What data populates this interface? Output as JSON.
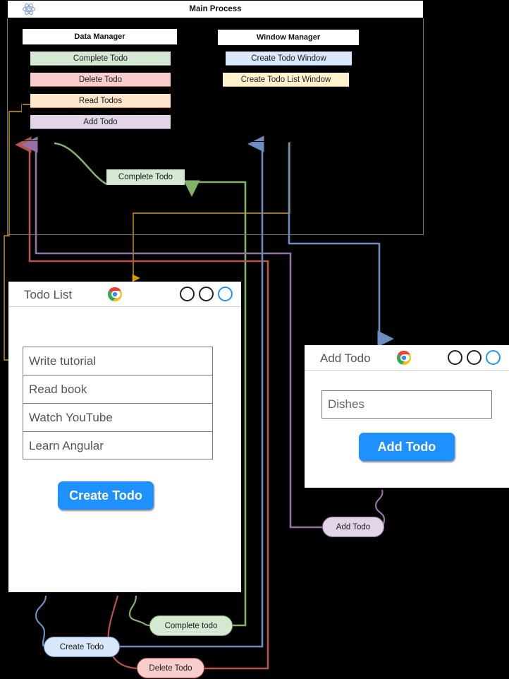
{
  "main_process": {
    "title": "Main Process",
    "icon": "atom-icon"
  },
  "data_manager": {
    "title": "Data Manager",
    "items": [
      {
        "label": "Complete Todo",
        "color": "#d5e8d4",
        "border": "#82b366"
      },
      {
        "label": "Delete Todo",
        "color": "#f8cecc",
        "border": "#b85450"
      },
      {
        "label": "Read Todos",
        "color": "#ffe6cc",
        "border": "#d79b00"
      },
      {
        "label": "Add Todo",
        "color": "#e1d5e7",
        "border": "#9673a6"
      }
    ]
  },
  "window_manager": {
    "title": "Window Manager",
    "items": [
      {
        "label": "Create Todo Window",
        "color": "#dae8fc",
        "border": "#6c8ebf"
      },
      {
        "label": "Create Todo List Window",
        "color": "#fff2cc",
        "border": "#d6b656"
      }
    ]
  },
  "flow_labels": {
    "complete_todo_top": "Complete Todo",
    "add_todo": "Add Todo",
    "complete_todo": "Complete todo",
    "create_todo": "Create Todo",
    "delete_todo": "Delete Todo"
  },
  "todo_list_window": {
    "title": "Todo List",
    "browser_icon": "chrome-icon",
    "controls": [
      "minimize-circle",
      "maximize-circle",
      "close-circle"
    ],
    "items": [
      "Write tutorial",
      "Read book",
      "Watch YouTube",
      "Learn Angular"
    ],
    "button": "Create Todo"
  },
  "add_todo_window": {
    "title": "Add Todo",
    "browser_icon": "chrome-icon",
    "controls": [
      "minimize-circle",
      "maximize-circle",
      "close-circle"
    ],
    "input_value": "Dishes",
    "input_placeholder": "Dishes",
    "button": "Add Todo"
  },
  "colors": {
    "green": "#82b366",
    "red": "#b85450",
    "orange": "#d79b00",
    "purple": "#9673a6",
    "blue": "#6c8ebf",
    "accent_button": "#1e90ff"
  }
}
